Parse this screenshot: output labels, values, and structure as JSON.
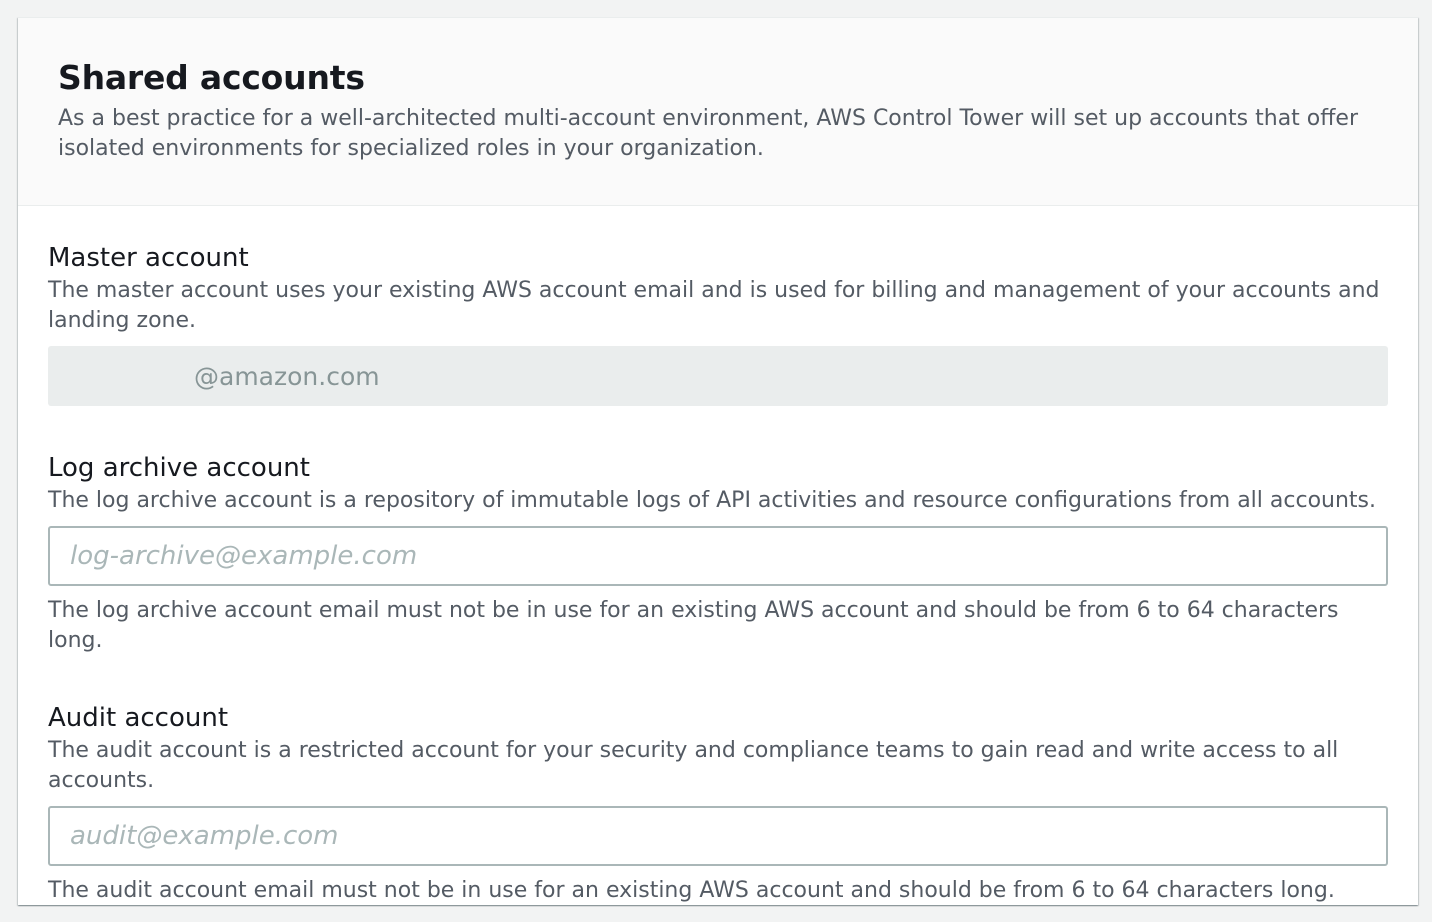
{
  "header": {
    "title": "Shared accounts",
    "description": "As a best practice for a well-architected multi-account environment, AWS Control Tower will set up accounts that offer isolated environments for specialized roles in your organization."
  },
  "master": {
    "label": "Master account",
    "description": "The master account uses your existing AWS account email and is used for billing and management of your accounts and landing zone.",
    "value": "@amazon.com"
  },
  "log_archive": {
    "label": "Log archive account",
    "description": "The log archive account is a repository of immutable logs of API activities and resource configurations from all accounts.",
    "placeholder": "log-archive@example.com",
    "constraint": "The log archive account email must not be in use for an existing AWS account and should be from 6 to 64 characters long."
  },
  "audit": {
    "label": "Audit account",
    "description": "The audit account is a restricted account for your security and compliance teams to gain read and write access to all accounts.",
    "placeholder": "audit@example.com",
    "constraint": "The audit account email must not be in use for an existing AWS account and should be from 6 to 64 characters long."
  }
}
